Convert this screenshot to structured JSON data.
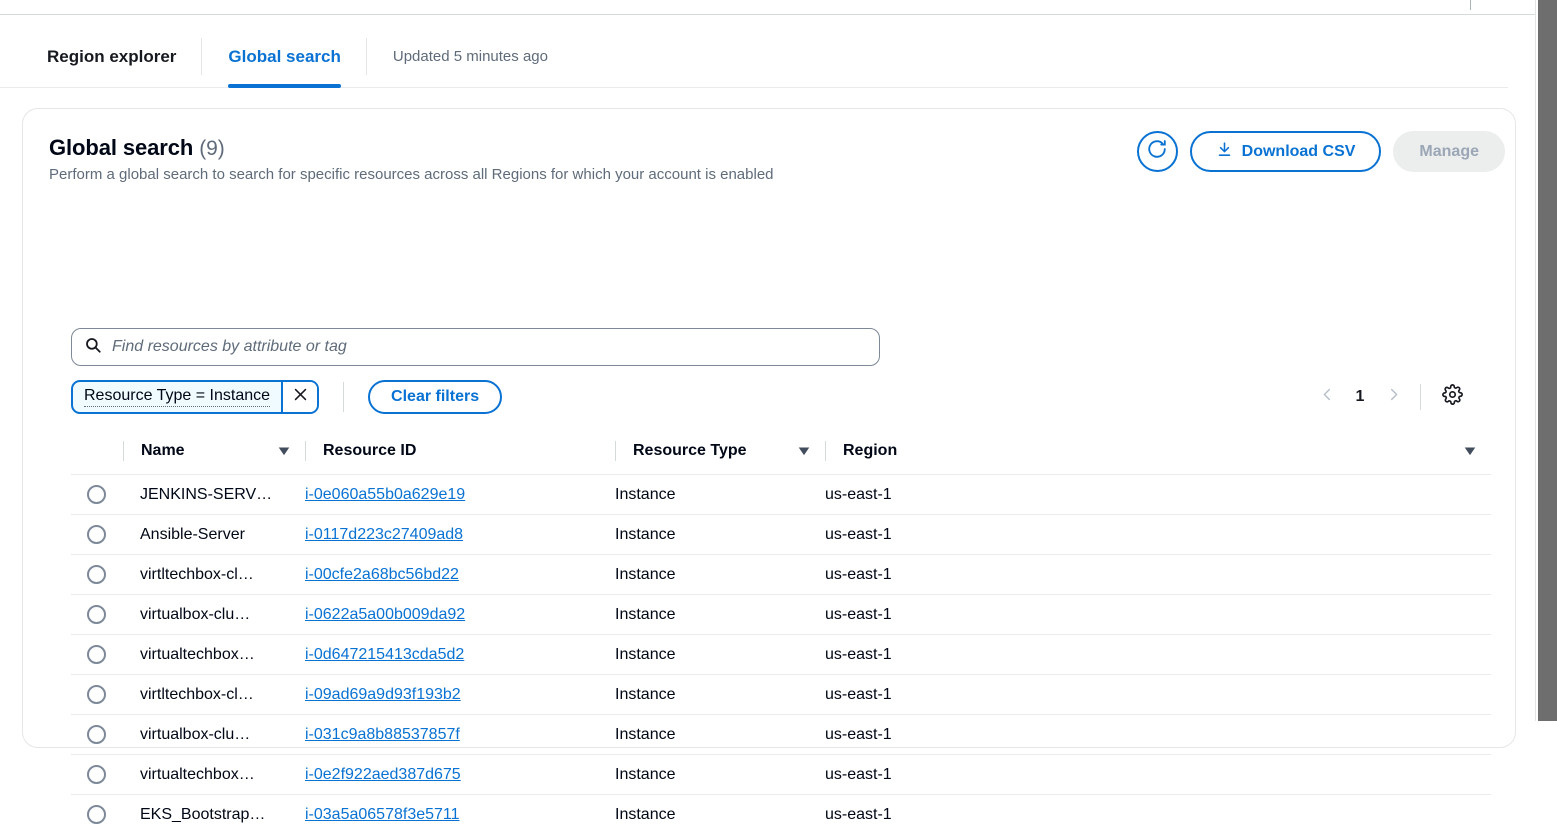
{
  "tabs": [
    {
      "label": "Region explorer",
      "active": false
    },
    {
      "label": "Global search",
      "active": true
    }
  ],
  "updated_text": "Updated 5 minutes ago",
  "panel": {
    "title": "Global search",
    "count": "(9)",
    "description": "Perform a global search to search for specific resources across all Regions for which your account is enabled",
    "refresh_icon": "refresh-icon",
    "download_label": "Download CSV",
    "download_icon": "download-icon",
    "manage_label": "Manage"
  },
  "search": {
    "placeholder": "Find resources by attribute or tag",
    "value": "",
    "icon": "search-icon"
  },
  "filters": {
    "chip_label": "Resource Type = Instance",
    "chip_remove_icon": "close-icon",
    "clear_label": "Clear filters"
  },
  "pagination": {
    "prev_icon": "chevron-left-icon",
    "page": "1",
    "next_icon": "chevron-right-icon",
    "settings_icon": "gear-icon"
  },
  "table": {
    "columns": [
      {
        "label": "Name",
        "sortable": true
      },
      {
        "label": "Resource ID",
        "sortable": false
      },
      {
        "label": "Resource Type",
        "sortable": true
      },
      {
        "label": "Region",
        "sortable": false
      }
    ],
    "trailing_sort_icon": "sort-descending-icon",
    "rows": [
      {
        "name": "JENKINS-SERV…",
        "resource_id": "i-0e060a55b0a629e19",
        "resource_type": "Instance",
        "region": "us-east-1"
      },
      {
        "name": "Ansible-Server",
        "resource_id": "i-0117d223c27409ad8",
        "resource_type": "Instance",
        "region": "us-east-1"
      },
      {
        "name": "virtltechbox-cl…",
        "resource_id": "i-00cfe2a68bc56bd22",
        "resource_type": "Instance",
        "region": "us-east-1"
      },
      {
        "name": "virtualbox-clu…",
        "resource_id": "i-0622a5a00b009da92",
        "resource_type": "Instance",
        "region": "us-east-1"
      },
      {
        "name": "virtualtechbox…",
        "resource_id": "i-0d647215413cda5d2",
        "resource_type": "Instance",
        "region": "us-east-1"
      },
      {
        "name": "virtltechbox-cl…",
        "resource_id": "i-09ad69a9d93f193b2",
        "resource_type": "Instance",
        "region": "us-east-1"
      },
      {
        "name": "virtualbox-clu…",
        "resource_id": "i-031c9a8b88537857f",
        "resource_type": "Instance",
        "region": "us-east-1"
      },
      {
        "name": "virtualtechbox…",
        "resource_id": "i-0e2f922aed387d675",
        "resource_type": "Instance",
        "region": "us-east-1"
      },
      {
        "name": "EKS_Bootstrap…",
        "resource_id": "i-03a5a06578f3e5711",
        "resource_type": "Instance",
        "region": "us-east-1"
      }
    ]
  },
  "colors": {
    "accent": "#0972d3",
    "text": "#000716",
    "muted": "#5f6b7a",
    "border": "#e9ebed",
    "chip_bg": "#f0fbff",
    "disabled_bg": "#eceded",
    "scrollbar": "#6e6e6e"
  }
}
